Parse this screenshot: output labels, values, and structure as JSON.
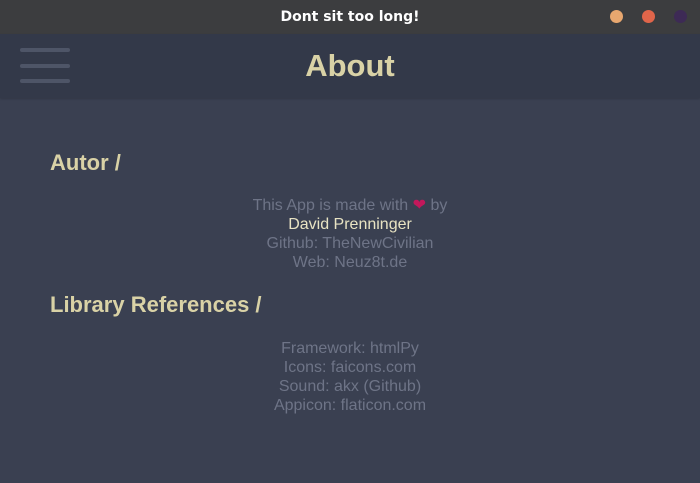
{
  "window": {
    "title": "Dont sit too long!",
    "buttons": {
      "minimize_color": "#e8a76f",
      "maximize_color": "#e0654a",
      "close_color": "#3d2a55"
    }
  },
  "header": {
    "title": "About",
    "menu_icon": "hamburger-menu-icon"
  },
  "colors": {
    "background": "#3a4051",
    "header_background": "#333949",
    "heading": "#d9d2a6",
    "muted_text": "#6e7487",
    "highlight_text": "#e8e3c3",
    "heart": "#c2185b"
  },
  "sections": {
    "autor": {
      "heading": "Autor /",
      "made_with_prefix": "This App is made with",
      "heart_icon": "heart-icon",
      "heart_glyph": "❤",
      "made_with_suffix": "by",
      "author_name": "David Prenninger",
      "github": "Github: TheNewCivilian",
      "web": "Web: Neuz8t.de"
    },
    "libraries": {
      "heading": "Library References /",
      "framework": "Framework: htmlPy",
      "icons": "Icons: faicons.com",
      "sound": "Sound: akx (Github)",
      "appicon": "Appicon: flaticon.com"
    }
  }
}
